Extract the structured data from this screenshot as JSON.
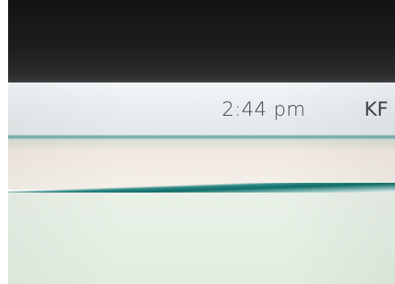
{
  "status_bar": {
    "clock": "2:44  pm",
    "locale": "KF"
  },
  "colors": {
    "bezel": "#1a1a1a",
    "status_bar_bg": "#e9eef0",
    "accent_line": "#0f6d69",
    "header_band": "#f2ebe4",
    "content_bg": "#e6f0e5",
    "text": "#3c4448"
  }
}
